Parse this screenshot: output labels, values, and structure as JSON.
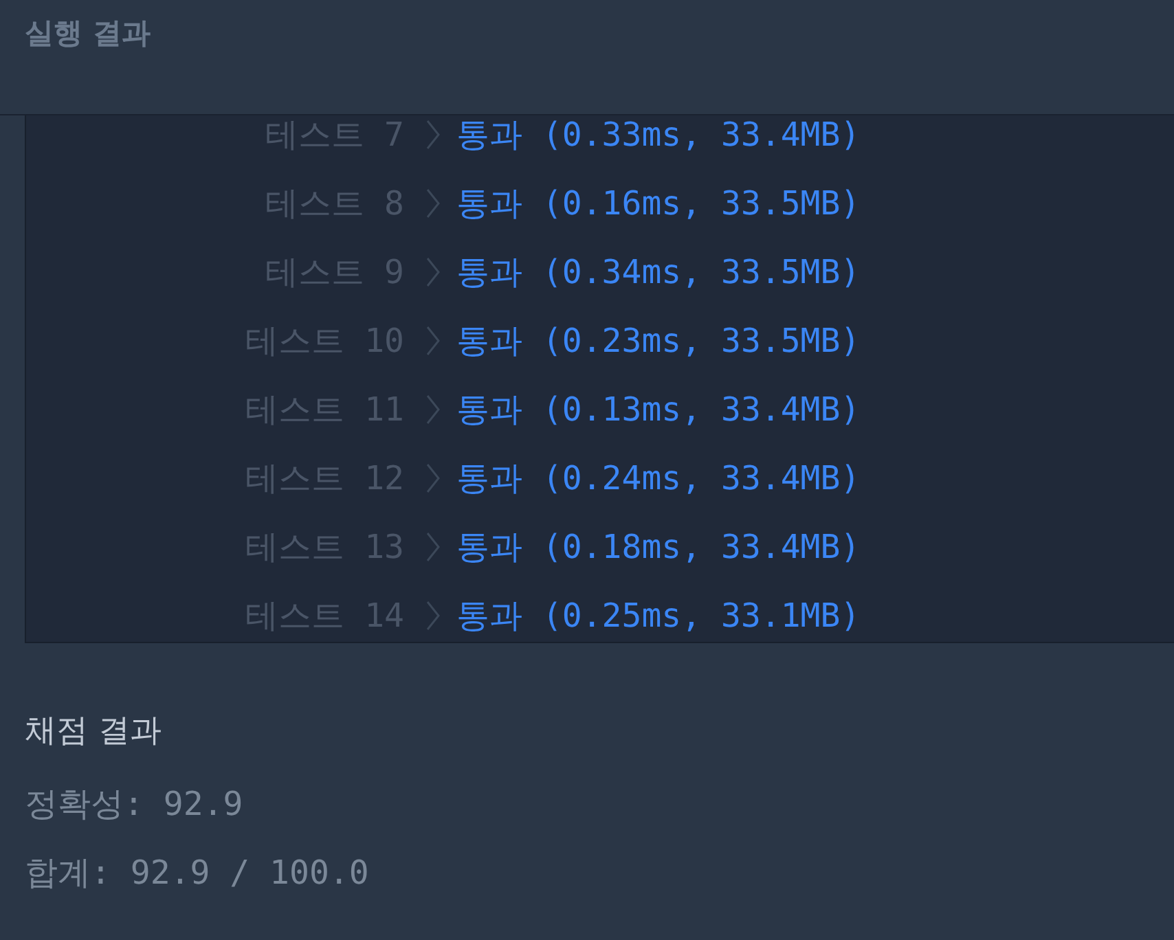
{
  "header": {
    "title": "실행 결과"
  },
  "tests": [
    {
      "label": "테스트 7",
      "result": "통과 (0.33ms, 33.4MB)",
      "kind": "pass"
    },
    {
      "label": "테스트 8",
      "result": "통과 (0.16ms, 33.5MB)",
      "kind": "pass"
    },
    {
      "label": "테스트 9",
      "result": "통과 (0.34ms, 33.5MB)",
      "kind": "pass"
    },
    {
      "label": "테스트 10",
      "result": "통과 (0.23ms, 33.5MB)",
      "kind": "pass"
    },
    {
      "label": "테스트 11",
      "result": "통과 (0.13ms, 33.4MB)",
      "kind": "pass"
    },
    {
      "label": "테스트 12",
      "result": "통과 (0.24ms, 33.4MB)",
      "kind": "pass"
    },
    {
      "label": "테스트 13",
      "result": "통과 (0.18ms, 33.4MB)",
      "kind": "pass"
    },
    {
      "label": "테스트 14",
      "result": "통과 (0.25ms, 33.1MB)",
      "kind": "pass"
    }
  ],
  "grading": {
    "title": "채점 결과",
    "lines": [
      "정확성: 92.9",
      "합계: 92.9 / 100.0"
    ]
  }
}
